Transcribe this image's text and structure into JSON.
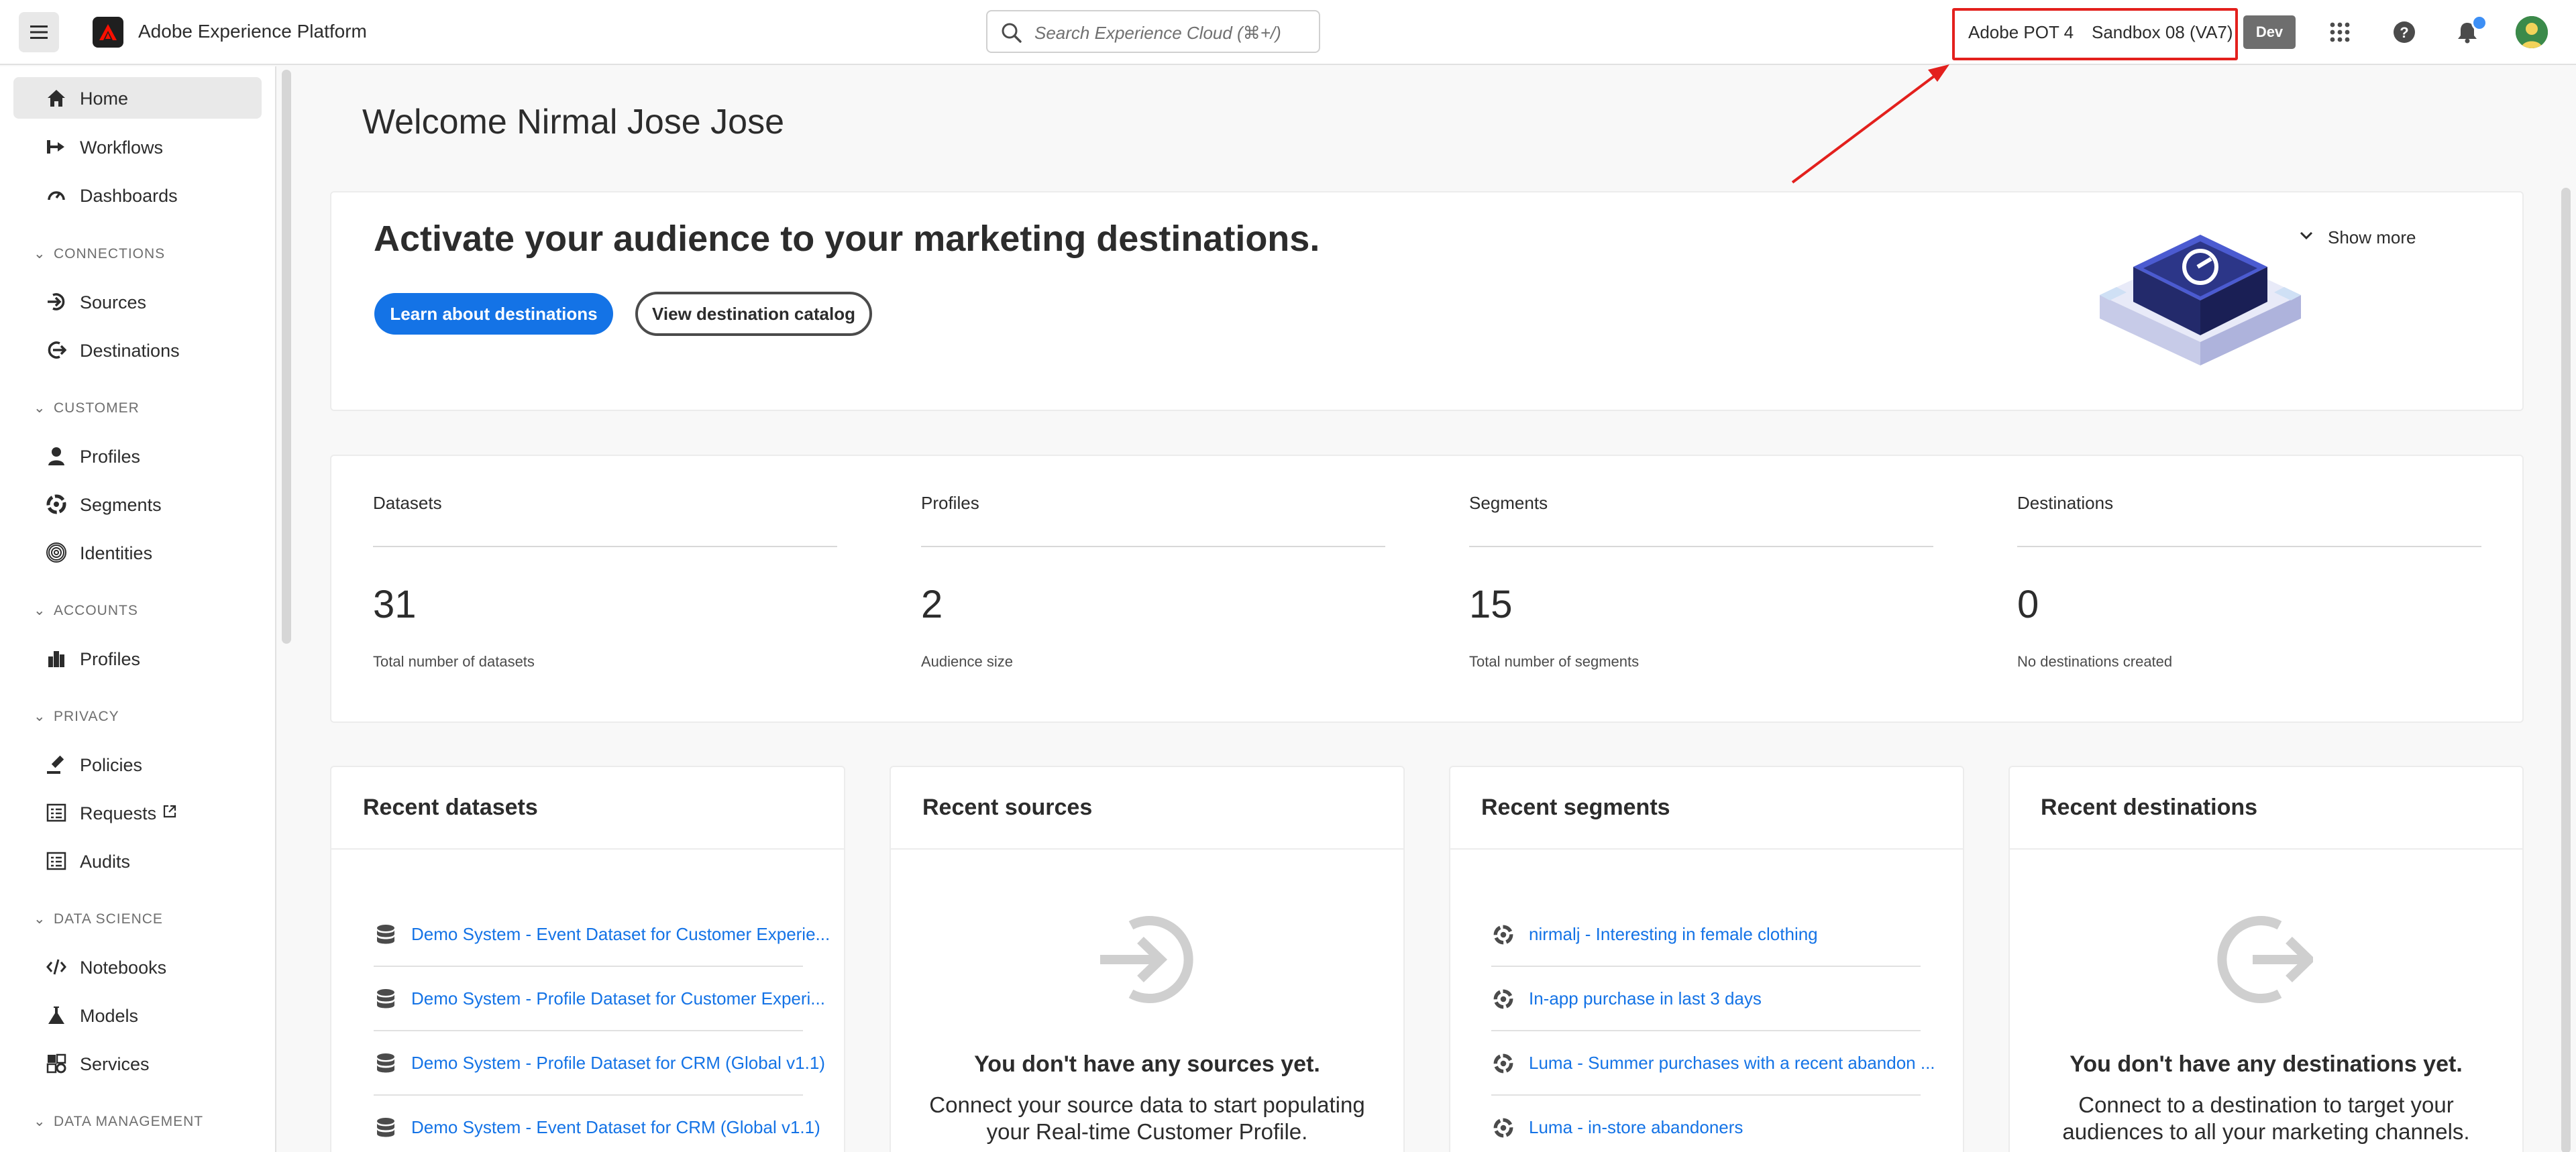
{
  "topbar": {
    "app_title": "Adobe Experience Platform",
    "search_placeholder": "Search Experience Cloud (⌘+/)",
    "org_name": "Adobe POT 4",
    "sandbox_name": "Sandbox 08 (VA7)",
    "env_badge": "Dev",
    "icons": [
      "menu-icon",
      "adobe-logo",
      "search-icon",
      "apps-grid-icon",
      "help-icon",
      "bell-icon",
      "avatar"
    ],
    "accent": "#e3201d",
    "notification_dot_color": "#3d8ff5"
  },
  "sidebar": {
    "items": [
      {
        "label": "Home",
        "icon": "home-icon",
        "active": true
      },
      {
        "label": "Workflows",
        "icon": "workflows-icon"
      },
      {
        "label": "Dashboards",
        "icon": "dashboard-icon"
      },
      {
        "section": "CONNECTIONS"
      },
      {
        "label": "Sources",
        "icon": "sources-icon"
      },
      {
        "label": "Destinations",
        "icon": "destinations-icon"
      },
      {
        "section": "CUSTOMER"
      },
      {
        "label": "Profiles",
        "icon": "profile-icon"
      },
      {
        "label": "Segments",
        "icon": "segments-icon"
      },
      {
        "label": "Identities",
        "icon": "fingerprint-icon"
      },
      {
        "section": "ACCOUNTS"
      },
      {
        "label": "Profiles",
        "icon": "account-profiles-icon"
      },
      {
        "section": "PRIVACY"
      },
      {
        "label": "Policies",
        "icon": "policies-icon"
      },
      {
        "label": "Requests",
        "icon": "requests-icon",
        "external": true
      },
      {
        "label": "Audits",
        "icon": "audits-icon"
      },
      {
        "section": "DATA SCIENCE"
      },
      {
        "label": "Notebooks",
        "icon": "notebooks-icon"
      },
      {
        "label": "Models",
        "icon": "models-icon"
      },
      {
        "label": "Services",
        "icon": "services-icon"
      },
      {
        "section": "DATA MANAGEMENT"
      }
    ]
  },
  "main": {
    "welcome": "Welcome Nirmal Jose Jose",
    "hero": {
      "title": "Activate your audience to your marketing destinations.",
      "primary_button": "Learn about destinations",
      "secondary_button": "View destination catalog",
      "show_more": "Show more"
    },
    "stats": [
      {
        "label": "Datasets",
        "value": "31",
        "sub": "Total number of datasets"
      },
      {
        "label": "Profiles",
        "value": "2",
        "sub": "Audience size"
      },
      {
        "label": "Segments",
        "value": "15",
        "sub": "Total number of segments"
      },
      {
        "label": "Destinations",
        "value": "0",
        "sub": "No destinations created"
      }
    ],
    "recent_datasets": {
      "title": "Recent datasets",
      "items": [
        "Demo System - Event Dataset for Customer Experie...",
        "Demo System - Profile Dataset for Customer Experi...",
        "Demo System - Profile Dataset for CRM (Global v1.1)",
        "Demo System - Event Dataset for CRM (Global v1.1)"
      ]
    },
    "recent_sources": {
      "title": "Recent sources",
      "empty_title": "You don't have any sources yet.",
      "empty_desc_1": "Connect your source data to start populating",
      "empty_desc_2": "your Real-time Customer Profile."
    },
    "recent_segments": {
      "title": "Recent segments",
      "items": [
        "nirmalj - Interesting in female clothing",
        "In-app purchase in last 3 days",
        "Luma - Summer purchases with a recent abandon ...",
        "Luma - in-store abandoners"
      ]
    },
    "recent_destinations": {
      "title": "Recent destinations",
      "empty_title": "You don't have any destinations yet.",
      "empty_desc_1": "Connect to a destination to target your",
      "empty_desc_2": "audiences to all your marketing channels."
    }
  },
  "colors": {
    "link": "#1473e6",
    "primary_button": "#1473e6",
    "highlight_box": "#e3201d"
  }
}
